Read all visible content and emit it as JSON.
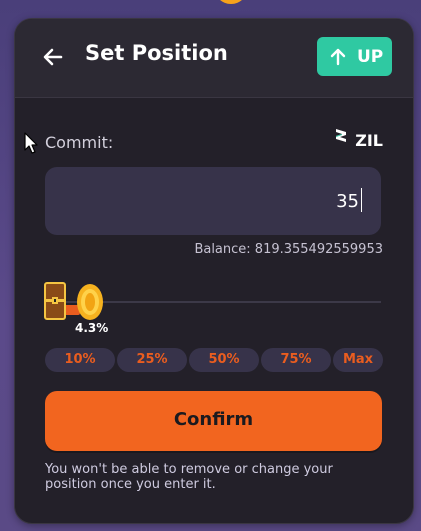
{
  "header": {
    "title": "Set Position",
    "up_label": "UP"
  },
  "commit": {
    "label": "Commit:",
    "token": "ZIL",
    "amount": "35",
    "balance_text": "Balance: 819.355492559953"
  },
  "slider": {
    "percent_text": "4.3%",
    "value_percent": 4.3
  },
  "quick_select": [
    "10%",
    "25%",
    "50%",
    "75%",
    "Max"
  ],
  "actions": {
    "confirm_label": "Confirm"
  },
  "warning": "You won't be able to remove or change your position once you enter it.",
  "colors": {
    "accent": "#f2651f",
    "up": "#2fc9a2",
    "card": "#232029",
    "panel": "#37334a"
  },
  "icons": [
    "back-arrow-icon",
    "up-arrow-icon",
    "zil-logo-icon",
    "treasure-chest-icon",
    "gold-coin-icon",
    "mouse-cursor-icon"
  ]
}
